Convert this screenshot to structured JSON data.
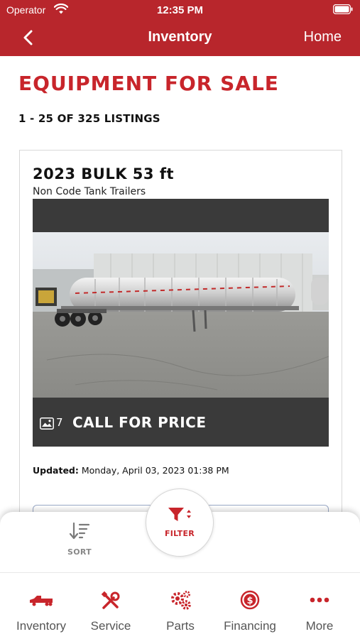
{
  "status": {
    "carrier": "Operator",
    "time": "12:35 PM"
  },
  "nav": {
    "title": "Inventory",
    "home_label": "Home"
  },
  "page": {
    "heading": "EQUIPMENT FOR SALE",
    "listing_count": "1 - 25 OF 325 LISTINGS"
  },
  "listing": {
    "title": "2023 BULK 53 ft",
    "category": "Non Code Tank Trailers",
    "photo_count": "7",
    "price": "CALL FOR PRICE",
    "updated_label": "Updated:",
    "updated_value": "Monday, April 03, 2023 01:38 PM"
  },
  "actions": {
    "sort_label": "SORT",
    "filter_label": "FILTER"
  },
  "tabs": [
    {
      "label": "Inventory",
      "icon": "truck-icon"
    },
    {
      "label": "Service",
      "icon": "tools-icon"
    },
    {
      "label": "Parts",
      "icon": "gears-icon"
    },
    {
      "label": "Financing",
      "icon": "dollar-icon"
    },
    {
      "label": "More",
      "icon": "more-icon"
    }
  ],
  "colors": {
    "brand": "#b8262c",
    "accent": "#c8252b",
    "caption_bg": "#3a3a3a"
  }
}
